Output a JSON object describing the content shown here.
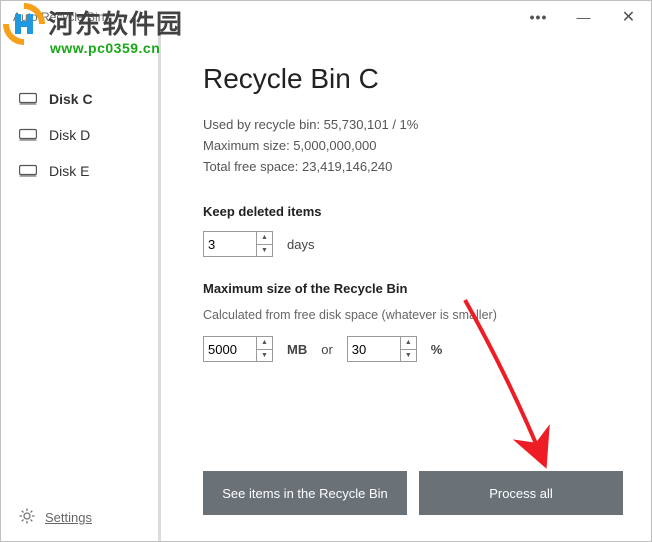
{
  "title": "Auto Recycle Bin",
  "watermark": {
    "cn": "河东软件园",
    "url": "www.pc0359.cn"
  },
  "sidebar": {
    "items": [
      {
        "label": "Disk C"
      },
      {
        "label": "Disk D"
      },
      {
        "label": "Disk E"
      }
    ],
    "settings": "Settings"
  },
  "main": {
    "heading": "Recycle Bin C",
    "used_label": "Used by recycle bin: 55,730,101 / 1%",
    "max_label": "Maximum size: 5,000,000,000",
    "free_label": "Total free space: 23,419,146,240",
    "keep_label": "Keep deleted items",
    "keep_value": "3",
    "keep_unit": "days",
    "maxsize_label": "Maximum size of the Recycle Bin",
    "calc_label": "Calculated from free disk space (whatever is smaller)",
    "mb_value": "5000",
    "mb_unit": "MB",
    "or_label": "or",
    "pct_value": "30",
    "pct_unit": "%",
    "btn_see": "See items in the Recycle Bin",
    "btn_process": "Process all"
  }
}
